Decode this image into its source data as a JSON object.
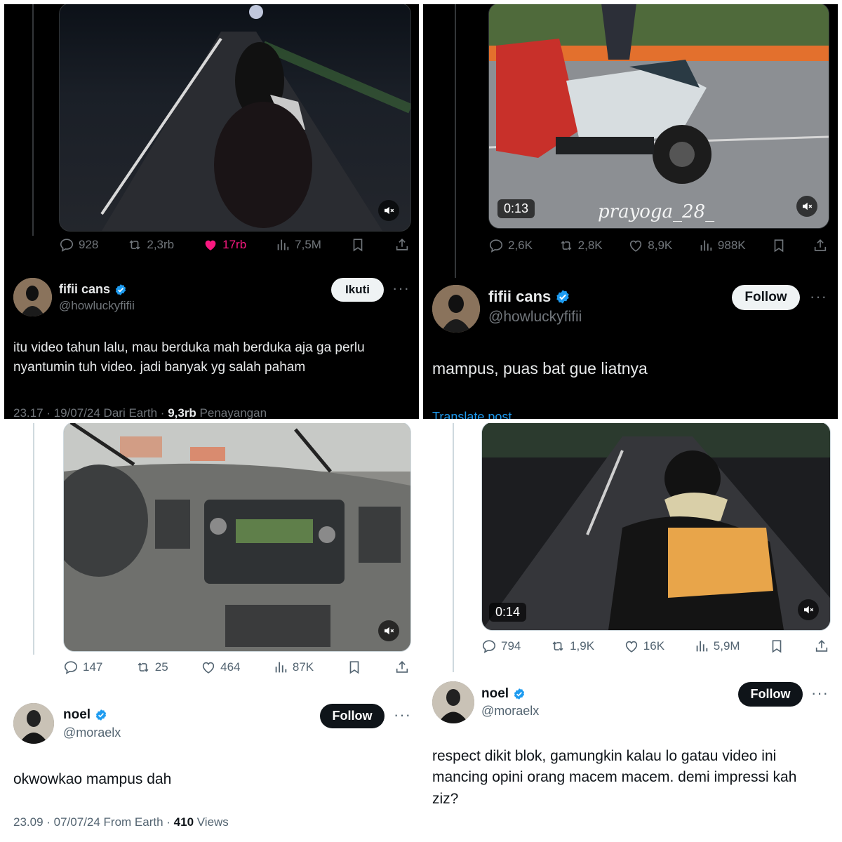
{
  "colors": {
    "accent": "#1d9bf0",
    "like": "#f91880",
    "dark_bg": "#000000",
    "light_bg": "#ffffff"
  },
  "icons": {
    "reply": "reply-icon",
    "repost": "repost-icon",
    "like": "heart-icon",
    "views": "views-icon",
    "bookmark": "bookmark-icon",
    "share": "share-icon",
    "mute": "mute-icon",
    "verified": "verified-badge-icon",
    "more": "more-icon"
  },
  "panels": [
    {
      "theme": "dark",
      "video": {
        "duration": ""
      },
      "stats": {
        "replies": "928",
        "reposts": "2,3rb",
        "likes": "17rb",
        "views": "7,5M",
        "liked": true
      },
      "author": {
        "name": "fifii cans",
        "handle": "@howluckyfifii",
        "follow_label": "Ikuti"
      },
      "text": "itu video tahun lalu, mau berduka mah berduka aja ga perlu nyantumin tuh video. jadi banyak yg salah paham",
      "meta": {
        "time": "23.17 · 19/07/24 Dari Earth · ",
        "views": "9,3rb",
        "views_label": " Penayangan"
      }
    },
    {
      "theme": "dark",
      "video": {
        "duration": "0:13",
        "watermark": "prayoga_28_"
      },
      "stats": {
        "replies": "2,6K",
        "reposts": "2,8K",
        "likes": "8,9K",
        "views": "988K",
        "liked": false
      },
      "author": {
        "name": "fifii cans",
        "handle": "@howluckyfifii",
        "follow_label": "Follow"
      },
      "text": "mampus, puas bat gue liatnya",
      "translate": "Translate post"
    },
    {
      "theme": "light",
      "video": {
        "duration": ""
      },
      "stats": {
        "replies": "147",
        "reposts": "25",
        "likes": "464",
        "views": "87K",
        "liked": false
      },
      "author": {
        "name": "noel",
        "handle": "@moraelx",
        "follow_label": "Follow"
      },
      "text": "okwowkao mampus dah",
      "meta": {
        "time": "23.09 · 07/07/24 From Earth · ",
        "views": "410",
        "views_label": " Views"
      }
    },
    {
      "theme": "light",
      "video": {
        "duration": "0:14"
      },
      "stats": {
        "replies": "794",
        "reposts": "1,9K",
        "likes": "16K",
        "views": "5,9M",
        "liked": false
      },
      "author": {
        "name": "noel",
        "handle": "@moraelx",
        "follow_label": "Follow"
      },
      "text": "respect dikit blok, gamungkin kalau lo gatau video ini mancing opini orang macem macem. demi impressi kah ziz?"
    }
  ]
}
